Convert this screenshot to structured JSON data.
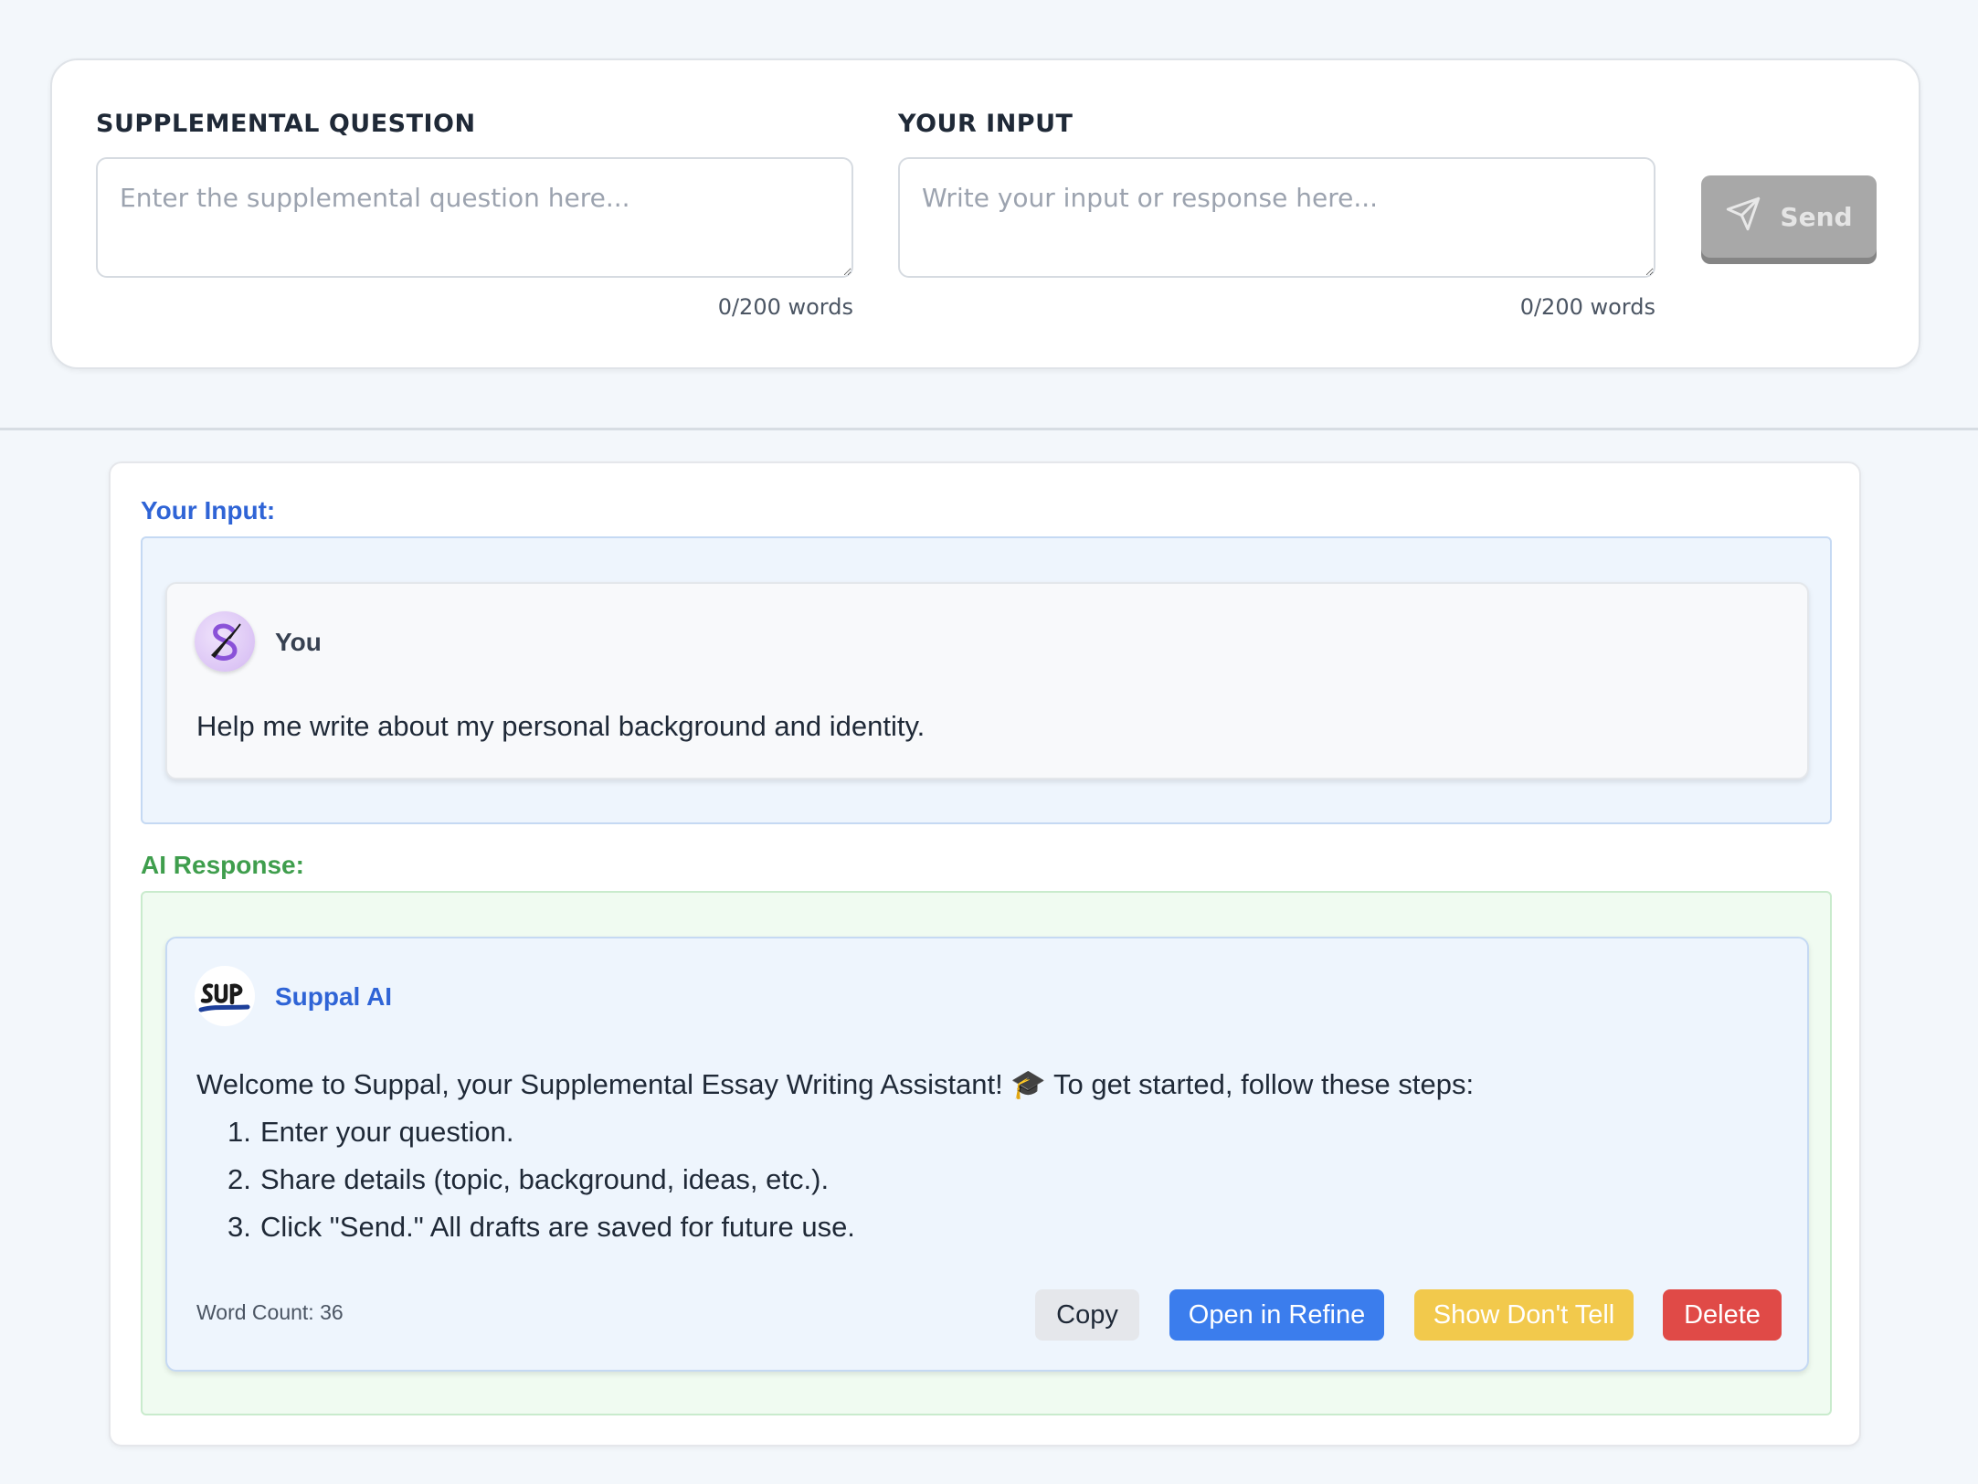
{
  "composer": {
    "question": {
      "label": "SUPPLEMENTAL QUESTION",
      "placeholder": "Enter the supplemental question here...",
      "value": "",
      "word_count": "0/200 words"
    },
    "input": {
      "label": "YOUR INPUT",
      "placeholder": "Write your input or response here...",
      "value": "",
      "word_count": "0/200 words"
    },
    "send_label": "Send",
    "send_icon": "send-paper-plane-icon",
    "send_disabled": true
  },
  "conversation": {
    "your_input_heading": "Your Input:",
    "ai_response_heading": "AI Response:",
    "user_message": {
      "sender": "You",
      "avatar_icon": "quill-pen-icon",
      "text": "Help me write about my personal background and identity."
    },
    "ai_message": {
      "sender": "Suppal AI",
      "avatar_icon": "suppal-logo-icon",
      "intro": "Welcome to Suppal, your Supplemental Essay Writing Assistant! 🎓 To get started, follow these steps:",
      "steps": [
        {
          "num": "1.",
          "text": "Enter your question."
        },
        {
          "num": "2.",
          "text": "Share details (topic, background, ideas, etc.)."
        },
        {
          "num": "3.",
          "text": "Click \"Send.\" All drafts are saved for future use."
        }
      ],
      "word_count": "Word Count: 36",
      "actions": {
        "copy": "Copy",
        "refine": "Open in Refine",
        "show_dont_tell": "Show Don't Tell",
        "delete": "Delete"
      }
    }
  },
  "colors": {
    "accent_blue": "#2f64d6",
    "accent_green": "#3f9e4d",
    "refine_button": "#3b7ded",
    "show_dont_tell_button": "#f2c94c",
    "delete_button": "#e04a47",
    "send_button_disabled": "#a8a8a8"
  }
}
